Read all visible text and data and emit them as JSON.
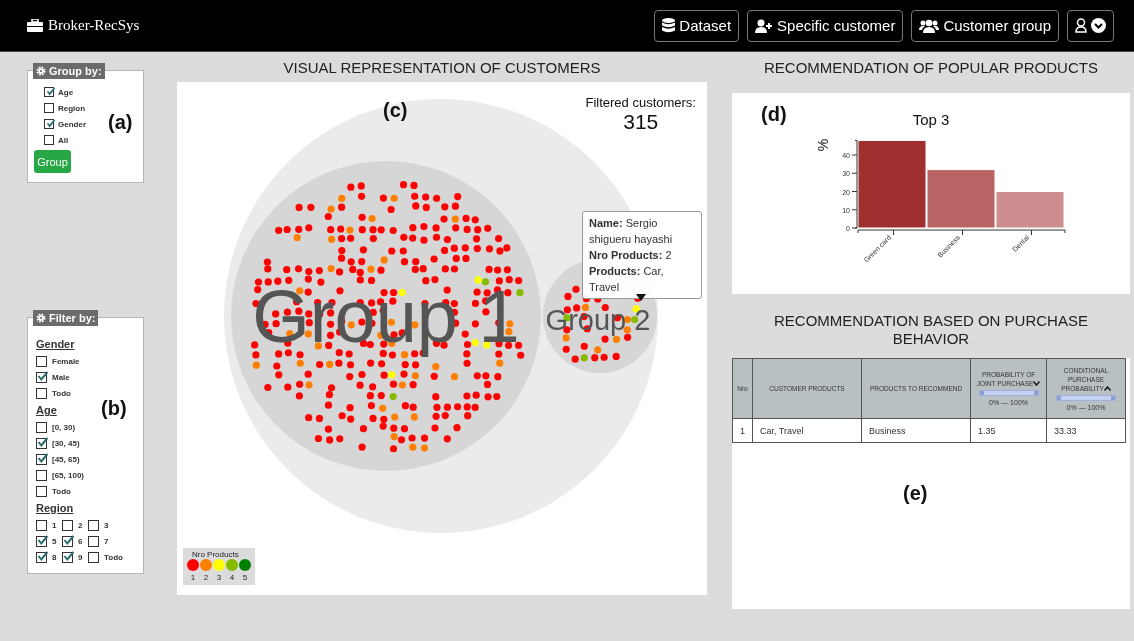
{
  "header": {
    "brand": "Broker-RecSys",
    "buttons": [
      {
        "label": "Dataset",
        "kind": "database"
      },
      {
        "label": "Specific customer",
        "kind": "user-plus"
      },
      {
        "label": "Customer group",
        "kind": "users"
      }
    ]
  },
  "group_by": {
    "title": "Group by:",
    "panel_label": "(a)",
    "options": [
      {
        "label": "Age",
        "checked": true
      },
      {
        "label": "Region",
        "checked": false
      },
      {
        "label": "Gender",
        "checked": true
      },
      {
        "label": "All",
        "checked": false
      }
    ],
    "button": "Group"
  },
  "filter_by": {
    "title": "Filter by:",
    "panel_label": "(b)",
    "sections": [
      {
        "heading": "Gender",
        "kind": "list",
        "options": [
          {
            "label": "Female",
            "checked": false
          },
          {
            "label": "Male",
            "checked": true
          },
          {
            "label": "Todo",
            "checked": false
          }
        ]
      },
      {
        "heading": "Age",
        "kind": "list",
        "options": [
          {
            "label": "[0, 30)",
            "checked": false
          },
          {
            "label": "[30, 45)",
            "checked": true
          },
          {
            "label": "[45, 65)",
            "checked": true
          },
          {
            "label": "[65, 100)",
            "checked": false
          },
          {
            "label": "Todo",
            "checked": false
          }
        ]
      },
      {
        "heading": "Region",
        "kind": "grid",
        "options": [
          {
            "label": "1",
            "checked": false
          },
          {
            "label": "2",
            "checked": false
          },
          {
            "label": "3",
            "checked": false
          },
          {
            "label": "5",
            "checked": true
          },
          {
            "label": "6",
            "checked": true
          },
          {
            "label": "7",
            "checked": false
          },
          {
            "label": "8",
            "checked": true
          },
          {
            "label": "9",
            "checked": true
          },
          {
            "label": "Todo",
            "checked": false
          }
        ]
      }
    ]
  },
  "customers": {
    "title": "VISUAL REPRESENTATION OF CUSTOMERS",
    "panel_label": "(c)",
    "filtered_label": "Filtered customers:",
    "filtered_count": "315",
    "groups": [
      {
        "name": "Group 1"
      },
      {
        "name": "Group 2"
      }
    ],
    "tooltip": [
      "**Name:** Sergio shigueru hayashi",
      "**Nro Products:** 2",
      "**Products:** Car, Travel"
    ],
    "legend": {
      "title": "Nro Products",
      "items": [
        {
          "label": "1",
          "color": "#ff0000"
        },
        {
          "label": "2",
          "color": "#ff8000"
        },
        {
          "label": "3",
          "color": "#ffff00"
        },
        {
          "label": "4",
          "color": "#88bb00"
        },
        {
          "label": "5",
          "color": "#008000"
        }
      ]
    }
  },
  "popular": {
    "title": "RECOMMENDATION OF POPULAR PRODUCTS",
    "panel_label": "(d)",
    "chart_data": {
      "type": "bar",
      "title": "Top 3",
      "ylabel": "%",
      "categories": [
        "Green card",
        "Business",
        "Dental"
      ],
      "series": [
        {
          "color": "#a03030",
          "values": [
            48,
            32,
            20
          ]
        }
      ],
      "ylim": [
        0,
        48
      ],
      "yticks": [
        0,
        10,
        20,
        30,
        40
      ]
    }
  },
  "behavior": {
    "title": "RECOMMENDATION BASED ON PURCHASE BEHAVIOR",
    "panel_label": "(e)",
    "columns": [
      {
        "label": "Nro",
        "kind": "plain"
      },
      {
        "label": "CUSTOMER PRODUCTS",
        "kind": "plain"
      },
      {
        "label": "PRODUCTS TO RECOMMEND",
        "kind": "plain"
      },
      {
        "label": "PROBABILITY OF JOINT PURCHASE",
        "kind": "range",
        "sort_descending": true,
        "range_label": "0% — 100%",
        "level": 1
      },
      {
        "label": "CONDITIONAL PURCHASE PROBABILITY",
        "kind": "range",
        "sort_descending": false,
        "range_label": "0% — 100%",
        "level": 1
      }
    ],
    "rows": [
      [
        "1",
        "Car, Travel",
        "Business",
        "1.35",
        "33.33"
      ]
    ]
  }
}
